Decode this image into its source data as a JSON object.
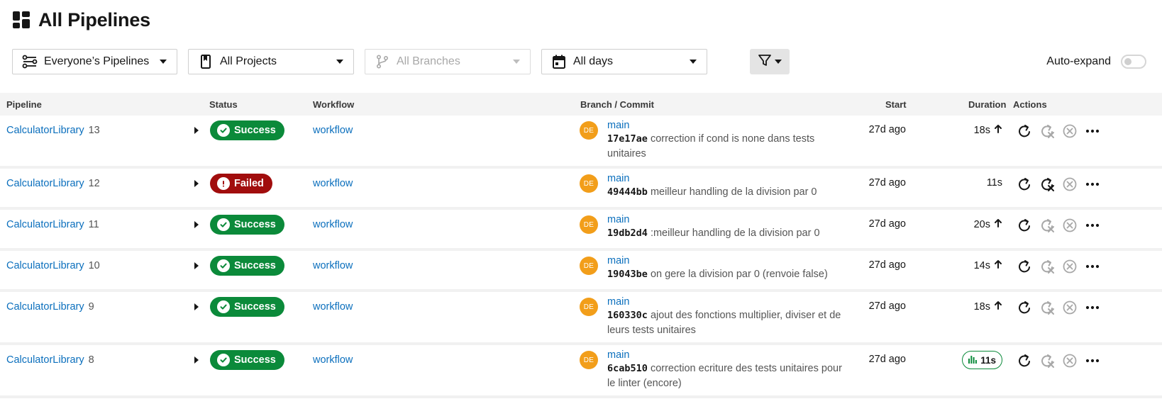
{
  "page": {
    "title": "All Pipelines"
  },
  "filters": {
    "pipelines": "Everyone’s Pipelines",
    "projects": "All Projects",
    "branches": "All Branches",
    "days": "All days"
  },
  "auto_expand": {
    "label": "Auto-expand",
    "on": false
  },
  "columns": {
    "pipeline": "Pipeline",
    "status": "Status",
    "workflow": "Workflow",
    "branch_commit": "Branch / Commit",
    "start": "Start",
    "duration": "Duration",
    "actions": "Actions"
  },
  "rows": [
    {
      "project": "CalculatorLibrary",
      "number": "13",
      "status": "Success",
      "workflow": "workflow",
      "avatar": "DE",
      "branch": "main",
      "hash": "17e17ae",
      "message": "correction if cond is none dans tests unitaires",
      "start": "27d ago",
      "duration": "18s",
      "trend": "up",
      "rerun_enabled": false
    },
    {
      "project": "CalculatorLibrary",
      "number": "12",
      "status": "Failed",
      "workflow": "workflow",
      "avatar": "DE",
      "branch": "main",
      "hash": "49444bb",
      "message": "meilleur handling de la division par 0",
      "start": "27d ago",
      "duration": "11s",
      "trend": "none",
      "rerun_enabled": true
    },
    {
      "project": "CalculatorLibrary",
      "number": "11",
      "status": "Success",
      "workflow": "workflow",
      "avatar": "DE",
      "branch": "main",
      "hash": "19db2d4",
      "message": ":meilleur handling de la division par 0",
      "start": "27d ago",
      "duration": "20s",
      "trend": "up",
      "rerun_enabled": false
    },
    {
      "project": "CalculatorLibrary",
      "number": "10",
      "status": "Success",
      "workflow": "workflow",
      "avatar": "DE",
      "branch": "main",
      "hash": "19043be",
      "message": "on gere la division par 0 (renvoie false)",
      "start": "27d ago",
      "duration": "14s",
      "trend": "up",
      "rerun_enabled": false
    },
    {
      "project": "CalculatorLibrary",
      "number": "9",
      "status": "Success",
      "workflow": "workflow",
      "avatar": "DE",
      "branch": "main",
      "hash": "160330c",
      "message": "ajout des fonctions multiplier, diviser et de leurs tests unitaires",
      "start": "27d ago",
      "duration": "18s",
      "trend": "up",
      "rerun_enabled": false
    },
    {
      "project": "CalculatorLibrary",
      "number": "8",
      "status": "Success",
      "workflow": "workflow",
      "avatar": "DE",
      "branch": "main",
      "hash": "6cab510",
      "message": "correction ecriture des tests unitaires pour le linter (encore)",
      "start": "27d ago",
      "duration": "11s",
      "trend": "insights",
      "rerun_enabled": false
    }
  ],
  "colors": {
    "link": "#0b6fbd",
    "success": "#0b8a3a",
    "failed": "#a10d0d",
    "avatar": "#f29e1a"
  },
  "icons": {
    "title": "dashboard-grid-icon",
    "pipelines_filter": "pipelines-icon",
    "projects_filter": "bookmark-icon",
    "branches_filter": "git-branch-icon",
    "days_filter": "calendar-icon",
    "filter_button": "funnel-icon",
    "success": "check-circle-icon",
    "failed": "exclamation-circle-icon",
    "trend_up": "arrow-up-icon",
    "insights": "bar-chart-icon",
    "rerun": "rerun-icon",
    "rerun_failed": "rerun-failed-icon",
    "cancel": "cancel-icon",
    "more": "more-icon"
  }
}
